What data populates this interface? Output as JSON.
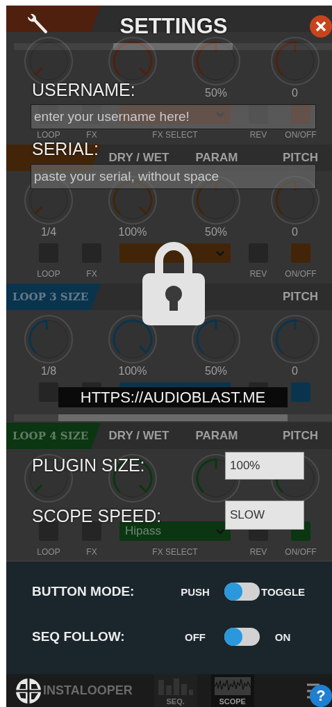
{
  "settings": {
    "title": "SETTINGS",
    "fields": [
      {
        "label": "USERNAME:",
        "placeholder": "enter your username here!"
      },
      {
        "label": "SERIAL:",
        "placeholder": "paste your serial, without space"
      }
    ],
    "link": "HTTPS://AUDIOBLAST.ME",
    "options": [
      {
        "label": "PLUGIN SIZE:",
        "value": "100%"
      },
      {
        "label": "SCOPE SPEED:",
        "value": "SLOW"
      }
    ],
    "toggles": [
      {
        "label": "BUTTON MODE:",
        "off_label": "PUSH",
        "on_label": "TOGGLE",
        "on": false
      },
      {
        "label": "SEQ FOLLOW:",
        "off_label": "OFF",
        "on_label": "ON",
        "on": false
      }
    ]
  },
  "loops": [
    {
      "color": "#5a2410",
      "on": true,
      "knobs": [
        {
          "kind": "dial"
        },
        {
          "kind": "dial",
          "level": 1
        },
        {
          "kind": "dial",
          "level": 0.5,
          "reading": "50%"
        },
        {
          "kind": "dial",
          "level": 0.5,
          "reading": "0"
        }
      ],
      "labels": {
        "loop": "LOOP",
        "fx": "FX",
        "fx_select": "FX SELECT",
        "rev": "REV",
        "on_off": "ON/OFF"
      }
    },
    {
      "color": "#4a2a0a",
      "on": true,
      "dry_wet_label": "DRY / WET",
      "param_label": "PARAM",
      "pitch_label": "PITCH",
      "knobs": [
        {
          "kind": "dial",
          "reading": "1/4"
        },
        {
          "kind": "dial",
          "level": 1,
          "reading": "100%"
        },
        {
          "kind": "dial",
          "level": 0.5,
          "reading": "50%"
        },
        {
          "kind": "dial",
          "level": 0.5,
          "reading": "0"
        }
      ],
      "labels": {
        "loop": "LOOP",
        "fx": "FX",
        "rev": "REV",
        "on_off": "ON/OFF"
      }
    },
    {
      "color": "#0c3a56",
      "on": true,
      "size_label": "LOOP 3 SIZE",
      "pitch_label": "PITCH",
      "knobs": [
        {
          "kind": "dial",
          "level": 0.47,
          "reading": "1/8"
        },
        {
          "kind": "dial",
          "level": 1,
          "reading": "100%"
        },
        {
          "kind": "dial",
          "level": 0.5,
          "reading": "50%"
        },
        {
          "kind": "dial",
          "level": 0.5,
          "reading": "0"
        }
      ]
    },
    {
      "color": "#0d3d14",
      "on": true,
      "size_label": "LOOP 4 SIZE",
      "dry_wet_label": "DRY / WET",
      "param_label": "PARAM",
      "pitch_label": "PITCH",
      "knobs": [
        {
          "kind": "dial"
        },
        {
          "kind": "dial",
          "level": 1
        },
        {
          "kind": "dial",
          "level": 0.5
        },
        {
          "kind": "dial",
          "level": 0.5
        }
      ],
      "fx_name": "Hipass",
      "labels": {
        "loop": "LOOP",
        "fx": "FX",
        "fx_select": "FX SELECT",
        "rev": "REV",
        "on_off": "ON/OFF"
      }
    }
  ],
  "footer": {
    "brand": "INSTALOOPER",
    "tabs": [
      {
        "label": "SEQ.",
        "kind": "seq",
        "selected": false
      },
      {
        "label": "SCOPE",
        "kind": "scope",
        "selected": true
      }
    ],
    "help": "?"
  }
}
